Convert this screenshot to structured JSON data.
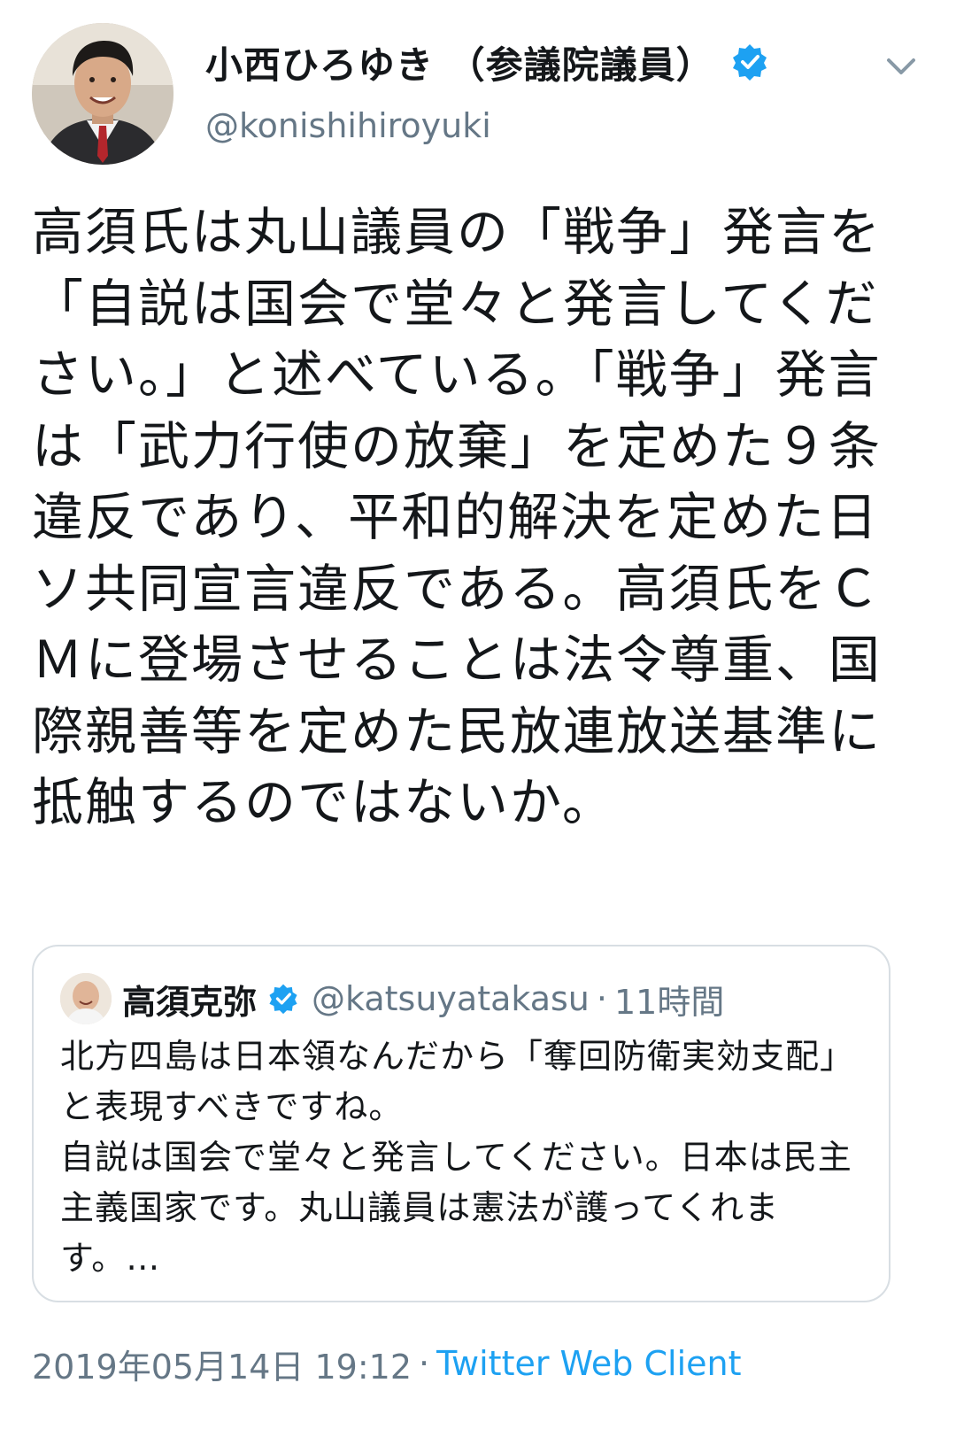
{
  "author": {
    "display_name": "小西ひろゆき （参議院議員）",
    "handle": "@konishihiroyuki",
    "verified": true,
    "avatar_icon": "user-avatar"
  },
  "menu": {
    "icon": "chevron-down-icon"
  },
  "tweet": {
    "text": "高須氏は丸山議員の「戦争」発言を「自説は国会で堂々と発言してください。」と述べている。「戦争」発言は「武力行使の放棄」を定めた９条違反であり、平和的解決を定めた日ソ共同宣言違反である。高須氏をＣＭに登場させることは法令尊重、国際親善等を定めた民放連放送基準に抵触するのではないか。"
  },
  "quoted_tweet": {
    "display_name": "高須克弥",
    "handle": "@katsuyatakasu",
    "separator": "·",
    "time": "11時間",
    "verified": true,
    "text": "北方四島は日本領なんだから「奪回防衛実効支配」と表現すべきですね。\n自説は国会で堂々と発言してください。日本は民主主義国家です。丸山議員は憲法が護ってくれます。…"
  },
  "meta": {
    "timestamp": "2019年05月14日 19:12",
    "separator": "·",
    "source": "Twitter Web Client"
  },
  "colors": {
    "text": "#14171a",
    "secondary": "#657786",
    "link": "#1da1f2",
    "verified": "#1da1f2",
    "border": "#d8dee3"
  }
}
